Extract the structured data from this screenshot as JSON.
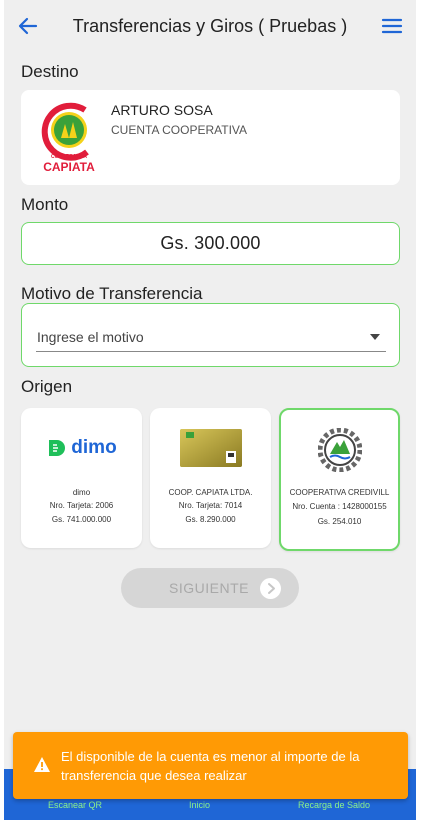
{
  "header": {
    "title": "Transferencias y Giros ( Pruebas )"
  },
  "destino": {
    "label": "Destino",
    "name": "ARTURO SOSA",
    "account_type": "CUENTA COOPERATIVA",
    "logo_text_top": "COOPERATIVA",
    "logo_text": "CAPIATA"
  },
  "monto": {
    "label": "Monto",
    "value": "Gs. 300.000"
  },
  "motivo": {
    "label": "Motivo de Transferencia",
    "placeholder": "Ingrese el motivo"
  },
  "origen": {
    "label": "Origen",
    "accounts": [
      {
        "logo_text": "dimo",
        "name": "dimo",
        "number": "Nro. Tarjeta: 2006",
        "balance": "Gs. 741.000.000"
      },
      {
        "name": "COOP. CAPIATA LTDA.",
        "number": "Nro. Tarjeta: 7014",
        "balance": "Gs. 8.290.000"
      },
      {
        "name": "COOPERATIVA CREDIVILL",
        "number": "Nro. Cuenta : 1428000155",
        "balance": "Gs. 254.010"
      }
    ]
  },
  "next_button": {
    "label": "SIGUIENTE"
  },
  "bottom_nav": {
    "scan": "Escanear QR",
    "home": "Inicio",
    "recharge": "Recarga de Saldo"
  },
  "toast": {
    "message": "El disponible de la cuenta es menor al importe de la transferencia que desea realizar"
  },
  "colors": {
    "primary": "#1f66d6",
    "accent_green": "#6fd86a",
    "warning": "#ff9a05"
  }
}
